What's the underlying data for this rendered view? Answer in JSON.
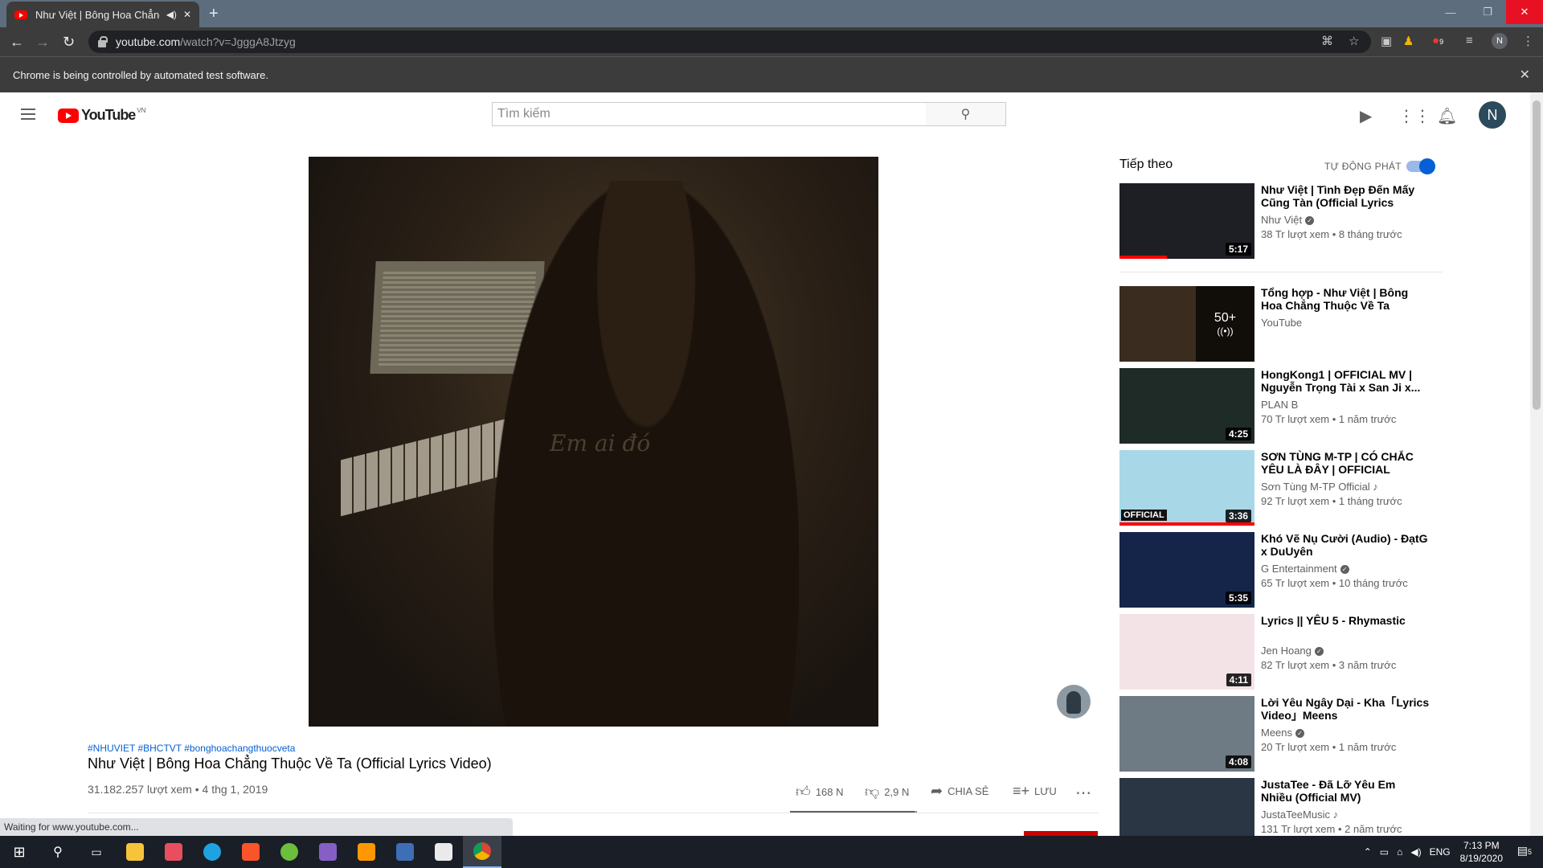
{
  "browser": {
    "tab_title": "Như Việt | Bông Hoa Chẳng",
    "tab_audio_icon": "speaker-icon",
    "url_host": "youtube.com",
    "url_path": "/watch?v=JgggA8Jtzyg",
    "infobar_text": "Chrome is being controlled by automated test software.",
    "profile_initial": "N",
    "extension_badge": "9"
  },
  "masthead": {
    "logo_text": "YouTube",
    "country_code": "VN",
    "search_placeholder": "Tìm kiếm",
    "avatar_initial": "N"
  },
  "video": {
    "watermark": "Em ai đó",
    "hashtags": "#NHUVIET #BHCTVT #bonghoachangthuocveta",
    "title": "Như Việt | Bông Hoa Chẳng Thuộc Về Ta (Official Lyrics Video)",
    "meta": "31.182.257 lượt xem • 4 thg 1, 2019",
    "likes": "168 N",
    "dislikes": "2,9 N",
    "share_label": "CHIA SẺ",
    "save_label": "LƯU",
    "like_ratio": 0.983
  },
  "upnext": {
    "heading": "Tiếp theo",
    "autoplay_label": "TỰ ĐỘNG PHÁT",
    "autoplay_on": true,
    "items": [
      {
        "title": "Như Việt | Tình Đẹp Đến Mấy Cũng Tàn (Official Lyrics Video)",
        "channel": "Như Việt",
        "verified": true,
        "meta": "38 Tr lượt xem • 8 tháng trước",
        "duration": "5:17",
        "watched": 0.35,
        "thumb_color": "#1d1f24"
      },
      {
        "title": "Tổng hợp - Như Việt | Bông Hoa Chẳng Thuộc Về Ta (Official...",
        "channel": "YouTube",
        "verified": false,
        "meta": "",
        "mix_count": "50+",
        "mix_icon": "live-radio-icon",
        "thumb_color": "#3a2c1e"
      },
      {
        "title": "HongKong1 | OFFICIAL MV | Nguyễn Trọng Tài x San Ji x...",
        "channel": "PLAN B",
        "verified": false,
        "meta": "70 Tr lượt xem • 1 năm trước",
        "duration": "4:25",
        "thumb_color": "#1f2b26"
      },
      {
        "title": "SƠN TÙNG M-TP | CÓ CHẮC YÊU LÀ ĐÂY | OFFICIAL MUSIC...",
        "channel": "Sơn Tùng M-TP Official",
        "music": true,
        "meta": "92 Tr lượt xem • 1 tháng trước",
        "duration": "3:36",
        "watched": 1.0,
        "badge": "OFFICIAL",
        "thumb_color": "#a8d8e8"
      },
      {
        "title": "Khó Vẽ Nụ Cười (Audio) - ĐạtG x DuUyên",
        "channel": "G Entertainment",
        "verified": true,
        "meta": "65 Tr lượt xem • 10 tháng trước",
        "duration": "5:35",
        "thumb_color": "#15254a"
      },
      {
        "title": "Lyrics || YÊU 5 - Rhymastic",
        "channel": "Jen Hoang",
        "verified": true,
        "meta": "82 Tr lượt xem • 3 năm trước",
        "duration": "4:11",
        "thumb_color": "#f3e3e6"
      },
      {
        "title": "Lời Yêu Ngây Dại - Kha「Lyrics Video」Meens",
        "channel": "Meens",
        "verified": true,
        "meta": "20 Tr lượt xem • 1 năm trước",
        "duration": "4:08",
        "thumb_color": "#6e7a84"
      },
      {
        "title": "JustaTee - Đã Lỡ Yêu Em Nhiều (Official MV)",
        "channel": "JustaTeeMusic",
        "music": true,
        "meta": "131 Tr lượt xem • 2 năm trước",
        "duration": "",
        "thumb_color": "#2a3644"
      }
    ]
  },
  "status_text": "Waiting for www.youtube.com...",
  "taskbar": {
    "lang": "ENG",
    "time": "7:13 PM",
    "date": "8/19/2020",
    "notif_count": "5"
  }
}
